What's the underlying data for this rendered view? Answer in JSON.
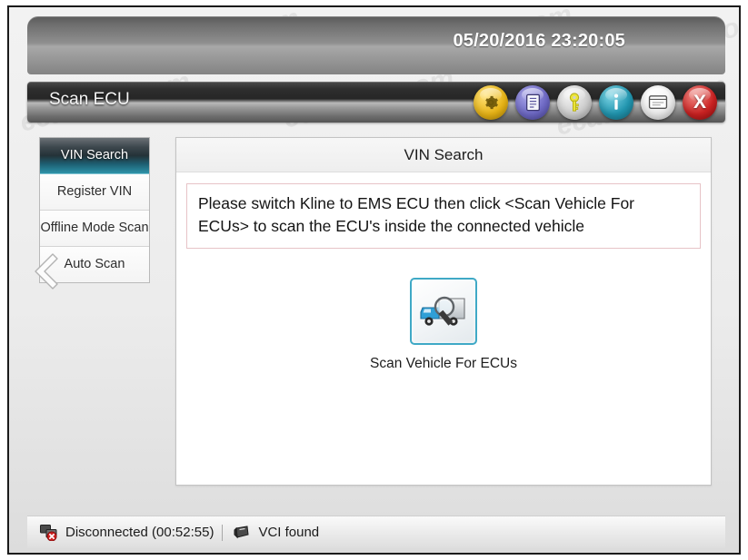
{
  "window": {
    "clock": "05/20/2016 23:20:05",
    "title": "Scan ECU"
  },
  "toolbar": {
    "icons": [
      {
        "name": "settings-gear-icon",
        "label": "Settings",
        "color": "#e8b415"
      },
      {
        "name": "document-icon",
        "label": "Report",
        "color": "#6f6ac6"
      },
      {
        "name": "key-icon",
        "label": "Security",
        "color": "#cfcfcf"
      },
      {
        "name": "info-icon",
        "label": "Information",
        "color": "#2196b0"
      },
      {
        "name": "window-icon",
        "label": "Display",
        "color": "#ededed"
      },
      {
        "name": "close-icon",
        "label": "X",
        "color": "#cc2222"
      }
    ]
  },
  "sidebar": {
    "items": [
      {
        "label": "VIN Search",
        "active": true
      },
      {
        "label": "Register VIN",
        "active": false
      },
      {
        "label": "Offline Mode Scan",
        "active": false
      },
      {
        "label": "Auto Scan",
        "active": false
      }
    ],
    "collapse_icon": "chevron-left-icon"
  },
  "content": {
    "panel_title": "VIN Search",
    "notice": "Please switch Kline to EMS ECU then click <Scan Vehicle For ECUs> to scan the ECU's inside the connected vehicle",
    "scan_button_label": "Scan Vehicle For ECUs",
    "scan_button_icon": "vehicle-magnifier-icon"
  },
  "status_bar": {
    "connection_icon": "network-disconnected-icon",
    "connection_text": "Disconnected (00:52:55)",
    "vci_icon": "vci-device-icon",
    "vci_text": "VCI found"
  },
  "watermark": {
    "text": "ecatalog.com"
  }
}
